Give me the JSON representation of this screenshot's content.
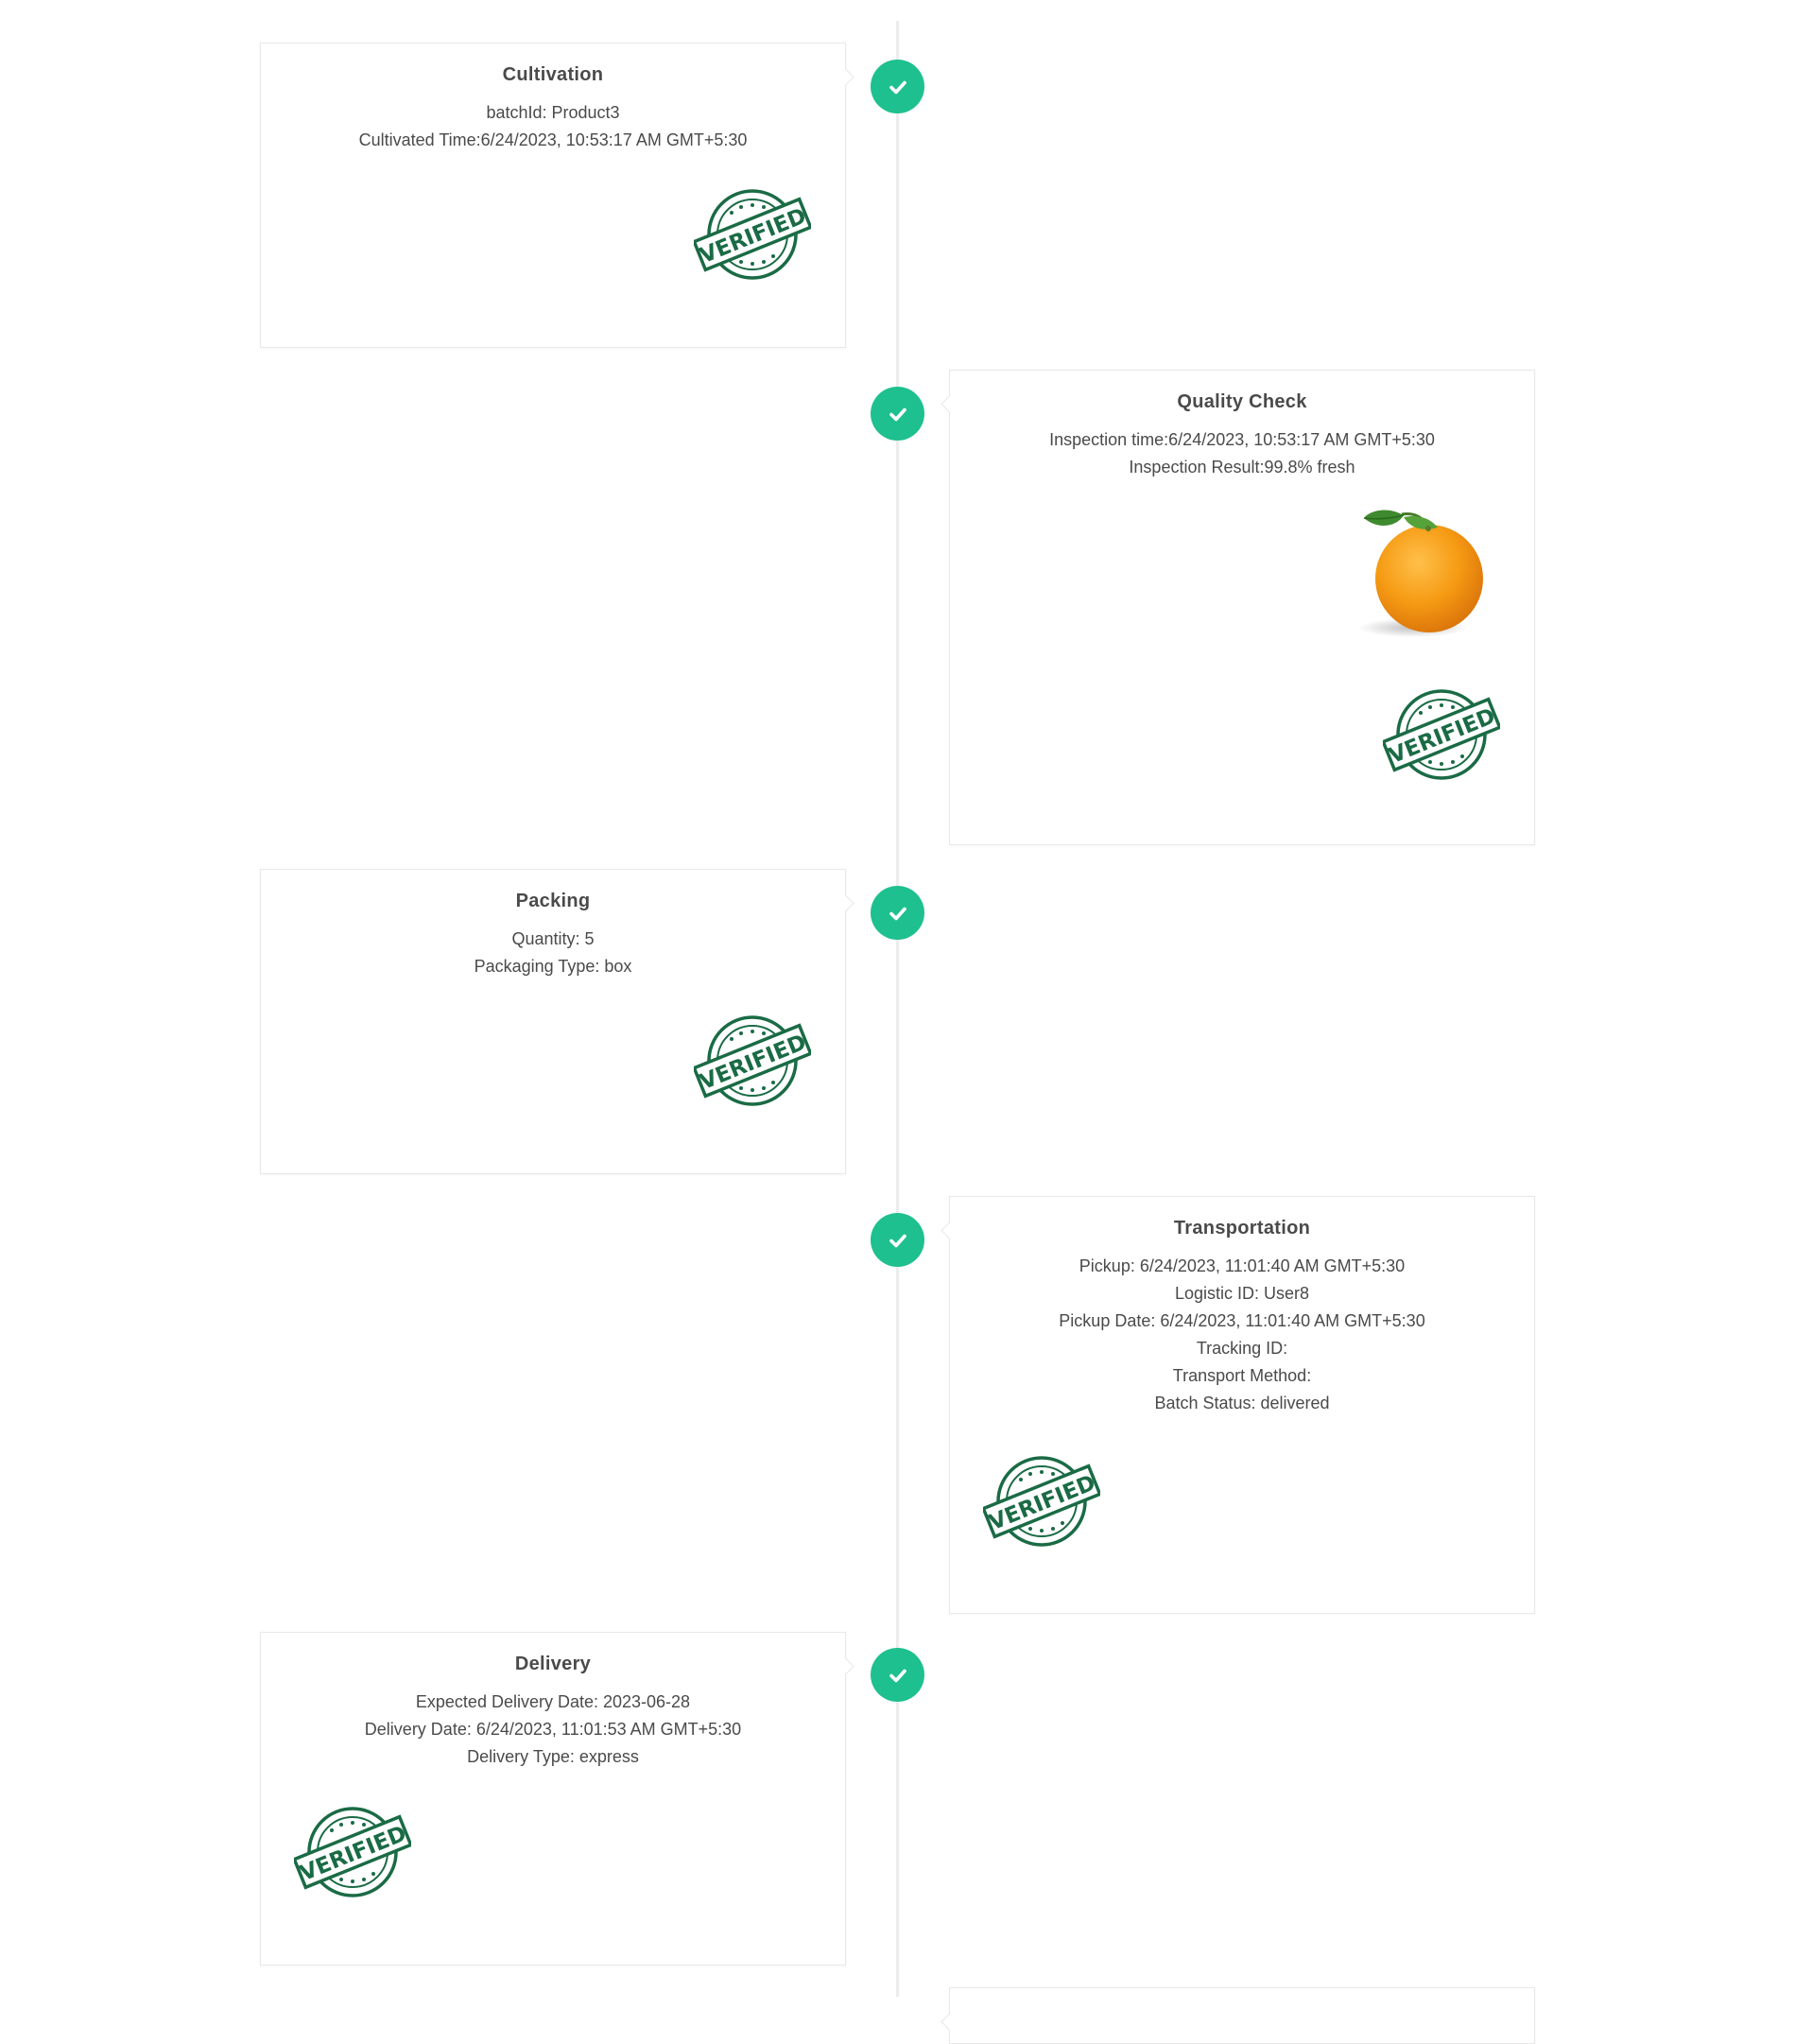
{
  "colors": {
    "accent": "#1ec08f",
    "stamp": "#1a6b45",
    "timeline": "#ececec"
  },
  "icons": {
    "marker": "check-icon",
    "stamp": "verified-stamp-icon",
    "product": "orange-fruit-image"
  },
  "stamp_text": "VERIFIED",
  "stages": {
    "cultivation": {
      "title": "Cultivation",
      "lines": [
        "batchId: Product3",
        "Cultivated Time:6/24/2023, 10:53:17 AM GMT+5:30"
      ]
    },
    "quality_check": {
      "title": "Quality Check",
      "lines": [
        "Inspection time:6/24/2023, 10:53:17 AM GMT+5:30",
        "Inspection Result:99.8% fresh"
      ]
    },
    "packing": {
      "title": "Packing",
      "lines": [
        "Quantity: 5",
        "Packaging Type: box"
      ]
    },
    "transportation": {
      "title": "Transportation",
      "lines": [
        "Pickup: 6/24/2023, 11:01:40 AM GMT+5:30",
        "Logistic ID: User8",
        "Pickup Date: 6/24/2023, 11:01:40 AM GMT+5:30",
        "Tracking ID:",
        "Transport Method:",
        "Batch Status: delivered"
      ]
    },
    "delivery": {
      "title": "Delivery",
      "lines": [
        "Expected Delivery Date: 2023-06-28",
        "Delivery Date: 6/24/2023, 11:01:53 AM GMT+5:30",
        "Delivery Type: express"
      ]
    }
  }
}
